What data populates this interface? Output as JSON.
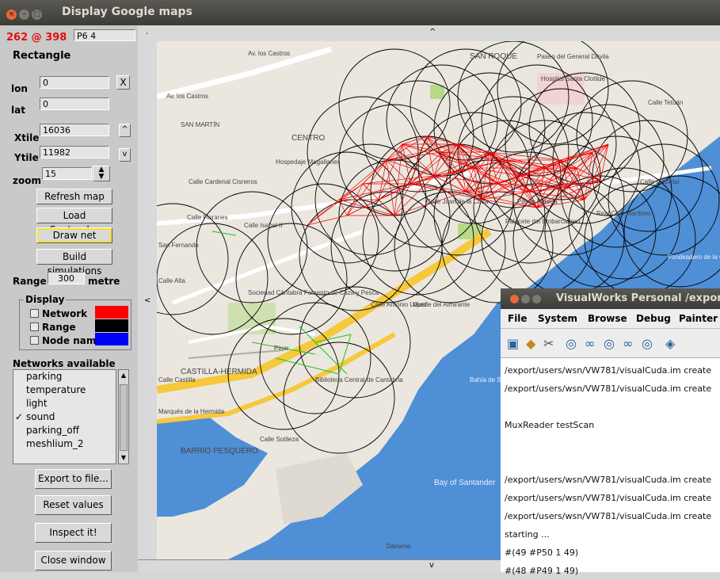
{
  "window": {
    "title": "Display Google maps"
  },
  "panel": {
    "coords": "262 @ 398",
    "coords_color": "#e01010",
    "pixel_field": "P6 4",
    "mode": "Rectangle",
    "lon_label": "lon",
    "lon_value": "0",
    "lon_button": "X",
    "lat_label": "lat",
    "lat_value": "0",
    "xtile_label": "Xtile",
    "xtile_value": "16036",
    "xtile_button": "^",
    "ytile_label": "Ytile",
    "ytile_value": "11982",
    "ytile_button": "v",
    "zoom_label": "zoom",
    "zoom_value": "15",
    "buttons": {
      "refresh": "Refresh map",
      "load": "Load Santander",
      "draw": "Draw net",
      "build": "Build simulations"
    },
    "range_label": "Range",
    "range_value": "300",
    "range_unit": "metre",
    "display": {
      "title": "Display",
      "items": [
        {
          "label": "Network",
          "color": "#ff0000"
        },
        {
          "label": "Range",
          "color": "#000000"
        },
        {
          "label": "Node name",
          "color": "#0000ff"
        }
      ]
    },
    "networks": {
      "title": "Networks available",
      "items": [
        {
          "label": "parking",
          "checked": false
        },
        {
          "label": "temperature",
          "checked": false
        },
        {
          "label": "light",
          "checked": false
        },
        {
          "label": "sound",
          "checked": true
        },
        {
          "label": "parking_off",
          "checked": false
        },
        {
          "label": "meshlium_2",
          "checked": false
        }
      ],
      "check_glyph": "✓"
    },
    "actions": {
      "export": "Export to file...",
      "reset": "Reset values",
      "inspect": "Inspect it!",
      "close": "Close window"
    }
  },
  "map_frame": {
    "up": "^",
    "down": "v",
    "left": "<"
  },
  "map_labels": [
    "Av. los Castros",
    "Av. los Castros",
    "SAN ROQUE",
    "Paseo del General Dávila",
    "Hospital Santa Clotilde",
    "SAN MARTÍN",
    "CENTRO",
    "Hospedaje Magallanes",
    "Calle Cardenal Cisneros",
    "Calle Floranes",
    "Calle Isabel II",
    "San Fernando",
    "Calle Alta",
    "Sociedad Cántabra Fomento de Caza y Pesca",
    "Calle Castilla",
    "CASTILLA-HERMIDA",
    "Marqués de la Hermida",
    "Biblioteca Central de Cantabria",
    "BARRIO PESQUERO",
    "Bay of Santander",
    "Calle Castelar",
    "Paseo Pereda",
    "Real Club Marítimo",
    "Fondeadero de la Osa",
    "Muelle del Almirante",
    "Bahía de Santander",
    "Calle Tetuán",
    "Calle Sotileza",
    "Pinar",
    "Calle Antonio López",
    "Palacete del Embarcadero",
    "Calle Juan de la Cosa",
    "Dársena"
  ],
  "vw": {
    "title": "VisualWorks Personal  /export/u",
    "menus": [
      "File",
      "System",
      "Browse",
      "Debug",
      "Painter"
    ],
    "lines": [
      "/export/users/wsn/VW781/visualCuda.im create",
      "/export/users/wsn/VW781/visualCuda.im create",
      "",
      "MuxReader  testScan",
      "",
      "",
      "/export/users/wsn/VW781/visualCuda.im create",
      "/export/users/wsn/VW781/visualCuda.im create",
      "/export/users/wsn/VW781/visualCuda.im create",
      "starting ...",
      "#(49 #P50 1 49)",
      "#(48 #P49 1 49)"
    ]
  }
}
